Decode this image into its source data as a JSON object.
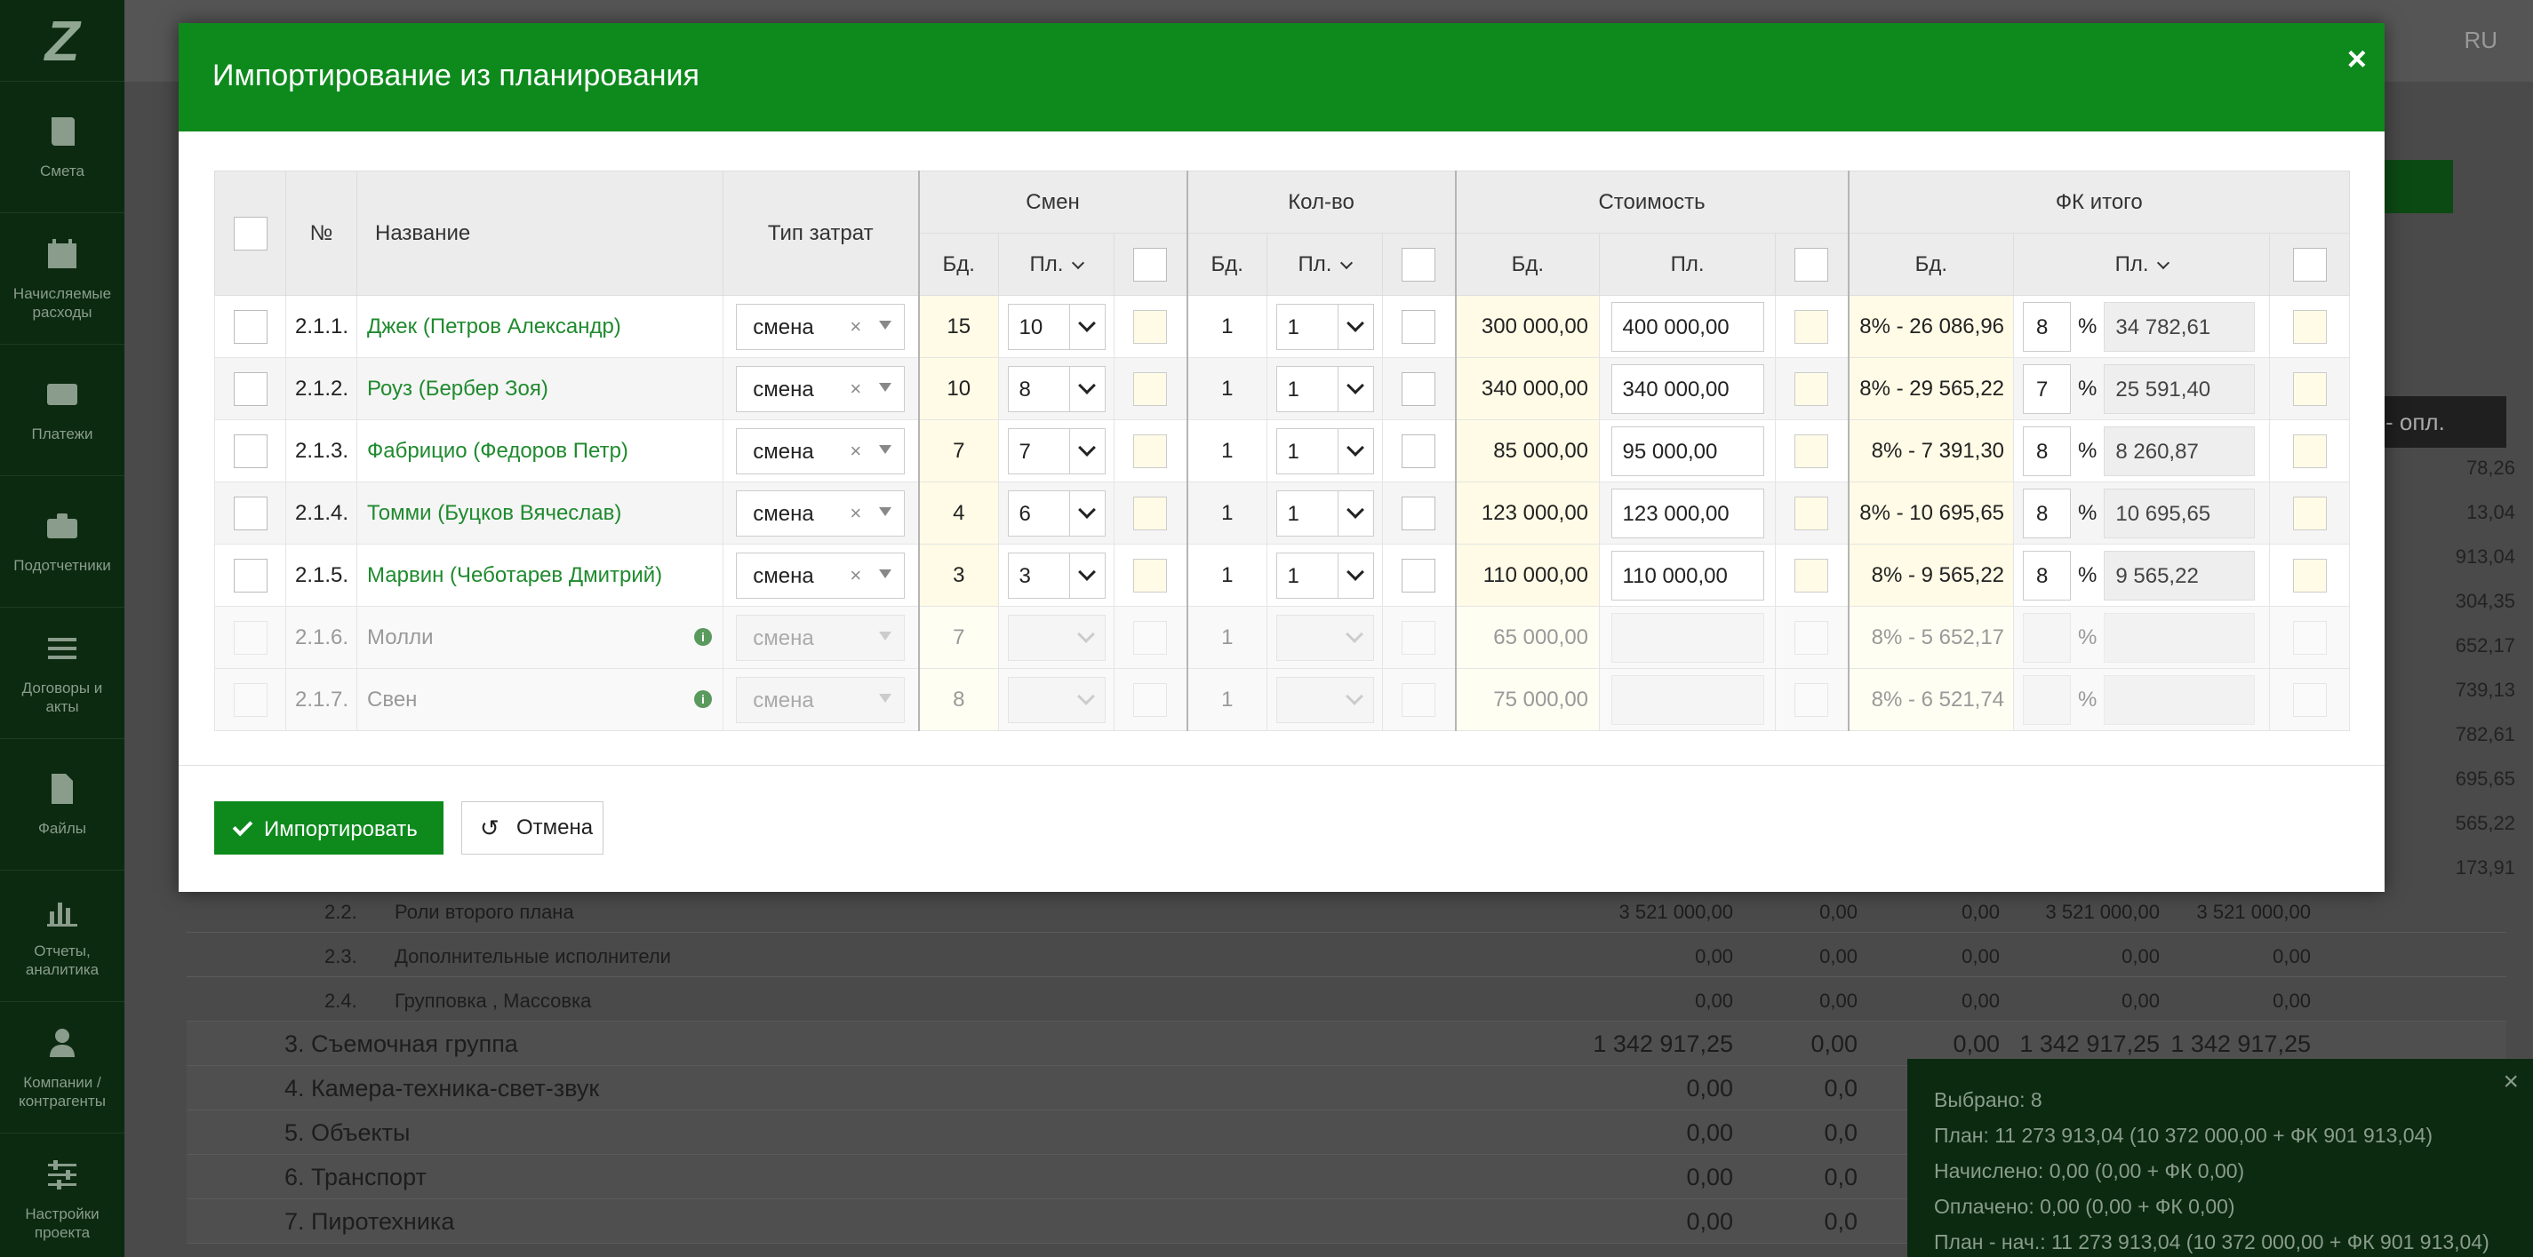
{
  "app": {
    "logo": "Z",
    "lang": "RU",
    "nav": [
      {
        "label": "Смета",
        "icon": "book-icon"
      },
      {
        "label": "Начисляемые расходы",
        "icon": "calendar-icon"
      },
      {
        "label": "Платежи",
        "icon": "card-icon"
      },
      {
        "label": "Подотчетники",
        "icon": "briefcase-icon"
      },
      {
        "label": "Договоры и акты",
        "icon": "list-icon"
      },
      {
        "label": "Файлы",
        "icon": "file-icon"
      },
      {
        "label": "Отчеты, аналитика",
        "icon": "chart-icon"
      },
      {
        "label": "Компании / контрагенты",
        "icon": "user-icon"
      },
      {
        "label": "Настройки проекта",
        "icon": "sliders-icon"
      }
    ]
  },
  "background": {
    "header_col": "- опл.",
    "right_values": [
      "78,26",
      "13,04",
      "913,04",
      "304,35",
      "652,17",
      "739,13",
      "782,61",
      "695,65",
      "565,22",
      "173,91"
    ],
    "rows": [
      {
        "num": "2.2.",
        "name": "Роли второго плана",
        "v1": "3 521 000,00",
        "v2": "0,00",
        "v3": "0,00",
        "v4": "3 521 000,00",
        "v5": "3 521 000,00"
      },
      {
        "num": "2.3.",
        "name": "Дополнительные исполнители",
        "v1": "0,00",
        "v2": "0,00",
        "v3": "0,00",
        "v4": "0,00",
        "v5": "0,00"
      },
      {
        "num": "2.4.",
        "name": "Групповка , Массовка",
        "v1": "0,00",
        "v2": "0,00",
        "v3": "0,00",
        "v4": "0,00",
        "v5": "0,00"
      }
    ],
    "groups": [
      {
        "name": "3. Съемочная группа",
        "v1": "1 342 917,25",
        "v2": "0,00",
        "v3": "0,00",
        "v4": "1 342 917,25",
        "v5": "1 342 917,25"
      },
      {
        "name": "4. Камера-техника-свет-звук",
        "v1": "0,00",
        "v2": "0,0"
      },
      {
        "name": "5. Объекты",
        "v1": "0,00",
        "v2": "0,0"
      },
      {
        "name": "6. Транспорт",
        "v1": "0,00",
        "v2": "0,0"
      },
      {
        "name": "7. Пиротехника",
        "v1": "0,00",
        "v2": "0,0"
      }
    ]
  },
  "selection": {
    "title": "Выбрано: 8",
    "plan": "План: 11 273 913,04 (10 372 000,00 + ФК 901 913,04)",
    "accrued": "Начислено: 0,00 (0,00 + ФК 0,00)",
    "paid": "Оплачено: 0,00 (0,00 + ФК 0,00)",
    "cut": "План - нач.: 11 273 913,04 (10 372 000,00 + ФК 901 913,04)"
  },
  "modal": {
    "title": "Импортирование из планирования",
    "close": "×",
    "headers": {
      "no": "№",
      "name": "Название",
      "cost_type": "Тип затрат",
      "shifts": "Смен",
      "qty": "Кол-во",
      "cost": "Стоимость",
      "fk": "ФК итого",
      "bd": "Бд.",
      "pl": "Пл."
    },
    "rows": [
      {
        "no": "2.1.1.",
        "name": "Джек (Петров Александр)",
        "type": "смена",
        "shift_bd": "15",
        "shift_pl": "10",
        "qty_bd": "1",
        "qty_pl": "1",
        "cost_bd": "300 000,00",
        "cost_pl": "400 000,00",
        "fk_bd": "8% - 26 086,96",
        "fk_pct": "8",
        "fk_pl": "34 782,61"
      },
      {
        "no": "2.1.2.",
        "name": "Роуз (Бербер Зоя)",
        "type": "смена",
        "shift_bd": "10",
        "shift_pl": "8",
        "qty_bd": "1",
        "qty_pl": "1",
        "cost_bd": "340 000,00",
        "cost_pl": "340 000,00",
        "fk_bd": "8% - 29 565,22",
        "fk_pct": "7",
        "fk_pl": "25 591,40"
      },
      {
        "no": "2.1.3.",
        "name": "Фабрицио (Федоров Петр)",
        "type": "смена",
        "shift_bd": "7",
        "shift_pl": "7",
        "qty_bd": "1",
        "qty_pl": "1",
        "cost_bd": "85 000,00",
        "cost_pl": "95 000,00",
        "fk_bd": "8% - 7 391,30",
        "fk_pct": "8",
        "fk_pl": "8 260,87"
      },
      {
        "no": "2.1.4.",
        "name": "Томми (Буцков Вячеслав)",
        "type": "смена",
        "shift_bd": "4",
        "shift_pl": "6",
        "qty_bd": "1",
        "qty_pl": "1",
        "cost_bd": "123 000,00",
        "cost_pl": "123 000,00",
        "fk_bd": "8% - 10 695,65",
        "fk_pct": "8",
        "fk_pl": "10 695,65"
      },
      {
        "no": "2.1.5.",
        "name": "Марвин (Чеботарев Дмитрий)",
        "type": "смена",
        "shift_bd": "3",
        "shift_pl": "3",
        "qty_bd": "1",
        "qty_pl": "1",
        "cost_bd": "110 000,00",
        "cost_pl": "110 000,00",
        "fk_bd": "8% - 9 565,22",
        "fk_pct": "8",
        "fk_pl": "9 565,22"
      },
      {
        "no": "2.1.6.",
        "name": "Молли",
        "type": "смена",
        "shift_bd": "7",
        "shift_pl": "",
        "qty_bd": "1",
        "qty_pl": "",
        "cost_bd": "65 000,00",
        "cost_pl": "",
        "fk_bd": "8% - 5 652,17",
        "fk_pct": "",
        "fk_pl": ""
      },
      {
        "no": "2.1.7.",
        "name": "Свен",
        "type": "смена",
        "shift_bd": "8",
        "shift_pl": "",
        "qty_bd": "1",
        "qty_pl": "",
        "cost_bd": "75 000,00",
        "cost_pl": "",
        "fk_bd": "8% - 6 521,74",
        "fk_pct": "",
        "fk_pl": ""
      }
    ],
    "pct_sign": "%",
    "clear": "×",
    "info": "i",
    "import_label": "Импортировать",
    "cancel_label": "Отмена",
    "cancel_icon": "↺"
  }
}
